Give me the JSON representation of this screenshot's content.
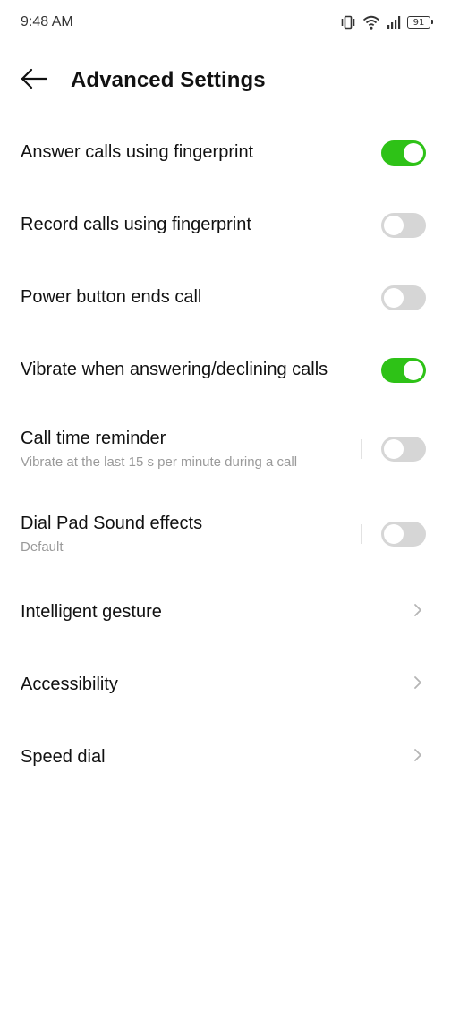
{
  "status_bar": {
    "time": "9:48 AM",
    "battery": "91",
    "icons": [
      "vibrate-icon",
      "wifi-icon",
      "signal-icon",
      "battery-icon"
    ]
  },
  "header": {
    "title": "Advanced Settings",
    "back_icon": "arrow-left-icon"
  },
  "colors": {
    "toggle_on": "#2ec217",
    "toggle_off": "#d6d6d6",
    "subtitle": "#9a9a9a"
  },
  "settings": {
    "answer_calls_fingerprint": {
      "label": "Answer calls using fingerprint",
      "enabled": true
    },
    "record_calls_fingerprint": {
      "label": "Record calls using fingerprint",
      "enabled": false
    },
    "power_button_ends_call": {
      "label": "Power button ends call",
      "enabled": false
    },
    "vibrate_answering": {
      "label": "Vibrate when answering/declining calls",
      "enabled": true
    },
    "call_time_reminder": {
      "label": "Call time reminder",
      "subtitle": "Vibrate at the last 15 s per minute during a call",
      "enabled": false
    },
    "dial_pad_sound": {
      "label": "Dial Pad Sound effects",
      "subtitle": "Default",
      "enabled": false
    },
    "intelligent_gesture": {
      "label": "Intelligent gesture"
    },
    "accessibility": {
      "label": "Accessibility"
    },
    "speed_dial": {
      "label": "Speed dial"
    }
  }
}
